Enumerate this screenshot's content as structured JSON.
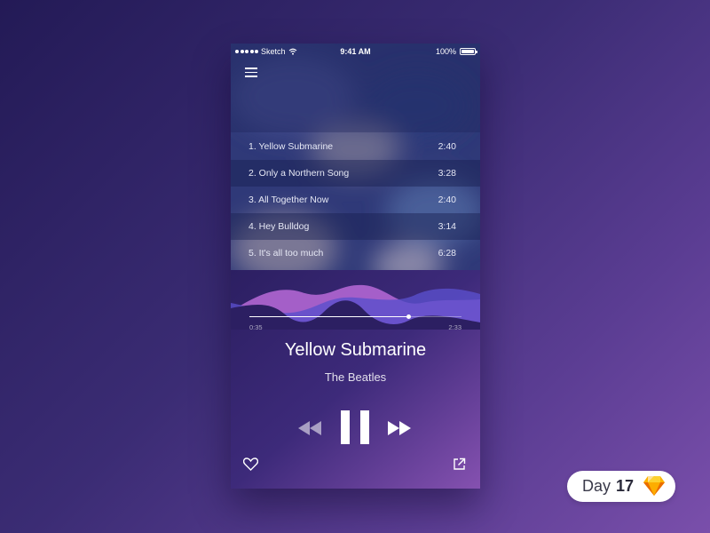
{
  "status_bar": {
    "carrier": "Sketch",
    "time": "9:41 AM",
    "battery": "100%"
  },
  "tracks": [
    {
      "label": "1. Yellow Submarine",
      "duration": "2:40"
    },
    {
      "label": "2. Only a Northern Song",
      "duration": "3:28"
    },
    {
      "label": "3. All Together Now",
      "duration": "2:40"
    },
    {
      "label": "4. Hey Bulldog",
      "duration": "3:14"
    },
    {
      "label": "5. It's all too much",
      "duration": "6:28"
    }
  ],
  "player": {
    "elapsed": "0:35",
    "total": "2:33",
    "progress_fraction": 0.75,
    "title": "Yellow Submarine",
    "artist": "The Beatles"
  },
  "icons": {
    "menu": "hamburger-menu-icon",
    "rewind": "rewind-icon",
    "pause": "pause-icon",
    "forward": "fast-forward-icon",
    "like": "heart-icon",
    "share": "share-icon",
    "logo": "sketch-gem-icon"
  },
  "badge": {
    "label": "Day",
    "number": "17"
  },
  "colors": {
    "wave_pink": "#b96ad8",
    "wave_purple": "#7a5ad0",
    "wave_blue": "#5a4fcc",
    "accent_gem": "#f7b21a"
  }
}
